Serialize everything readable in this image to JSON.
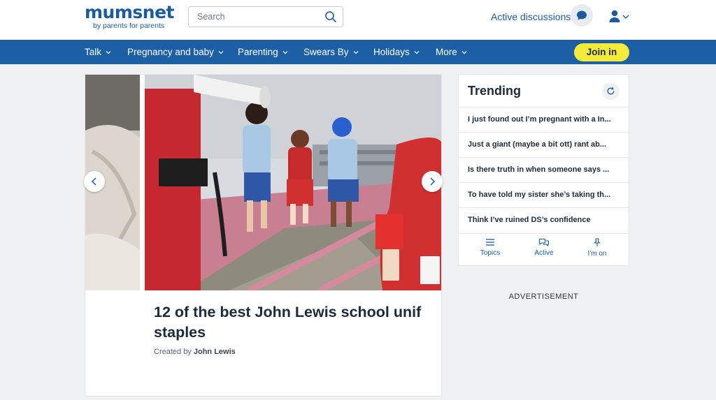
{
  "header": {
    "logo_main": "mumsnet",
    "logo_sub": "by parents for parents",
    "search_placeholder": "Search",
    "active_discussions": "Active discussions"
  },
  "nav": {
    "items": [
      {
        "label": "Talk"
      },
      {
        "label": "Pregnancy and baby"
      },
      {
        "label": "Parenting"
      },
      {
        "label": "Swears By"
      },
      {
        "label": "Holidays"
      },
      {
        "label": "More"
      }
    ],
    "join_label": "Join in"
  },
  "carousel": {
    "headline_line1": "12 of the best John Lewis school unif",
    "headline_line2": "staples",
    "credit_prefix": "Created by",
    "credit_name": "John Lewis"
  },
  "trending": {
    "title": "Trending",
    "items": [
      {
        "text": "I just found out I’m pregnant with a In..."
      },
      {
        "text": "Just a giant (maybe a bit ott) rant ab..."
      },
      {
        "text": "Is there truth in when someone says ..."
      },
      {
        "text": "To have told my sister she’s taking th..."
      },
      {
        "text": "Think I’ve ruined DS’s confidence"
      }
    ],
    "tabs": [
      {
        "label": "Topics",
        "icon": "menu-icon"
      },
      {
        "label": "Active",
        "icon": "chat-icon"
      },
      {
        "label": "I'm on",
        "icon": "pin-icon"
      }
    ]
  },
  "advertisement_label": "ADVERTISEMENT",
  "colors": {
    "brand_blue": "#1d5fa5",
    "join_yellow": "#f4ea3a",
    "page_bg": "#f0f1f3"
  }
}
